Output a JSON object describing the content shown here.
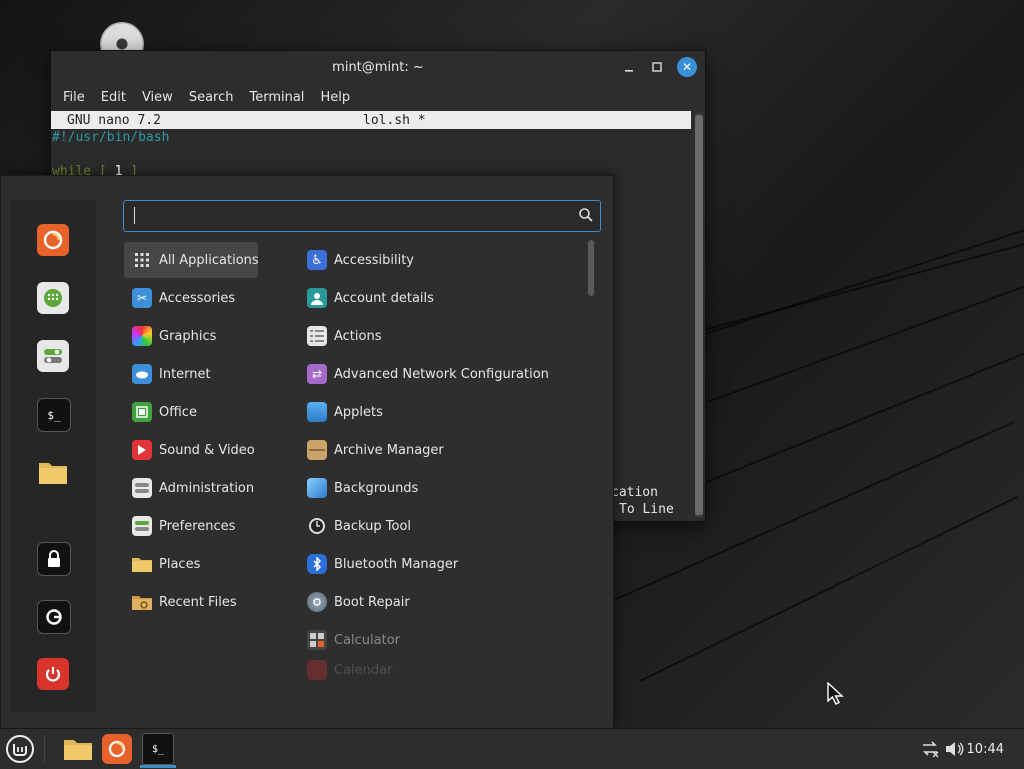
{
  "terminal": {
    "title": "mint@mint: ~",
    "menu": [
      "File",
      "Edit",
      "View",
      "Search",
      "Terminal",
      "Help"
    ],
    "nano_version": "GNU nano 7.2",
    "nano_file": "lol.sh *",
    "line1": "#!/usr/bin/bash",
    "line2_kw": "while [ ",
    "line2_num": "1",
    "line2_end": " ]",
    "shortcut_tail_1": "cation",
    "shortcut_tail_2": "To Line"
  },
  "menu": {
    "search_placeholder": "",
    "categories": [
      {
        "label": "All Applications",
        "icon": "grid-icon",
        "selected": true
      },
      {
        "label": "Accessories",
        "icon": "accessories-icon"
      },
      {
        "label": "Graphics",
        "icon": "graphics-icon"
      },
      {
        "label": "Internet",
        "icon": "internet-icon"
      },
      {
        "label": "Office",
        "icon": "office-icon"
      },
      {
        "label": "Sound & Video",
        "icon": "sound-video-icon"
      },
      {
        "label": "Administration",
        "icon": "administration-icon"
      },
      {
        "label": "Preferences",
        "icon": "preferences-icon"
      },
      {
        "label": "Places",
        "icon": "folder-icon"
      },
      {
        "label": "Recent Files",
        "icon": "recent-files-icon"
      }
    ],
    "apps": [
      {
        "label": "Accessibility",
        "icon": "accessibility-icon"
      },
      {
        "label": "Account details",
        "icon": "account-icon"
      },
      {
        "label": "Actions",
        "icon": "actions-icon"
      },
      {
        "label": "Advanced Network Configuration",
        "icon": "network-config-icon"
      },
      {
        "label": "Applets",
        "icon": "applets-icon"
      },
      {
        "label": "Archive Manager",
        "icon": "archive-icon"
      },
      {
        "label": "Backgrounds",
        "icon": "backgrounds-icon"
      },
      {
        "label": "Backup Tool",
        "icon": "backup-icon"
      },
      {
        "label": "Bluetooth Manager",
        "icon": "bluetooth-icon"
      },
      {
        "label": "Boot Repair",
        "icon": "boot-repair-icon"
      },
      {
        "label": "Calculator",
        "icon": "calculator-icon"
      },
      {
        "label": "Calendar",
        "icon": "calendar-icon"
      }
    ],
    "favorites": [
      "firefox-icon",
      "software-manager-icon",
      "system-settings-icon",
      "terminal-icon",
      "files-icon",
      "lock-screen-icon",
      "logout-icon",
      "power-icon"
    ]
  },
  "taskbar": {
    "clock": "10:44"
  },
  "colors": {
    "accent": "#3d8fc7",
    "firefox": "#e8622b",
    "power": "#d9342b"
  }
}
